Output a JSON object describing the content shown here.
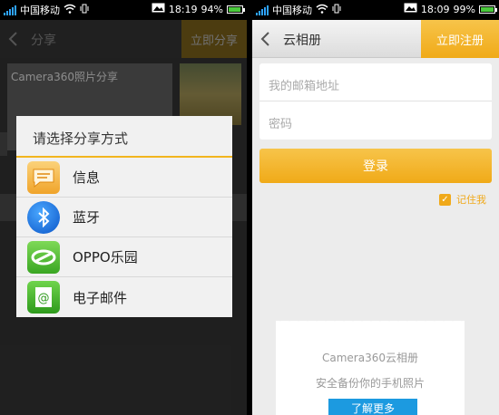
{
  "colors": {
    "accent": "#f0aa18",
    "blue": "#1c9ae0"
  },
  "left": {
    "status": {
      "carrier": "中国移动",
      "time": "18:19",
      "battery": "94%",
      "battery_level": 0.94
    },
    "titlebar": {
      "title": "分享",
      "action": "立即分享"
    },
    "underlay": {
      "card_text": "Camera360照片分享"
    },
    "dialog": {
      "title": "请选择分享方式",
      "options": [
        {
          "label": "信息",
          "icon": "message-icon"
        },
        {
          "label": "蓝牙",
          "icon": "bluetooth-icon"
        },
        {
          "label": "OPPO乐园",
          "icon": "oppo-paradise-icon"
        },
        {
          "label": "电子邮件",
          "icon": "email-icon"
        }
      ]
    }
  },
  "right": {
    "status": {
      "carrier": "中国移动",
      "time": "18:09",
      "battery": "99%",
      "battery_level": 0.99
    },
    "titlebar": {
      "title": "云相册",
      "action": "立即注册"
    },
    "form": {
      "email_placeholder": "我的邮箱地址",
      "password_placeholder": "密码"
    },
    "login_label": "登录",
    "remember_label": "记住我",
    "promo": {
      "line1": "Camera360云相册",
      "line2": "安全备份你的手机照片",
      "button": "了解更多"
    }
  }
}
